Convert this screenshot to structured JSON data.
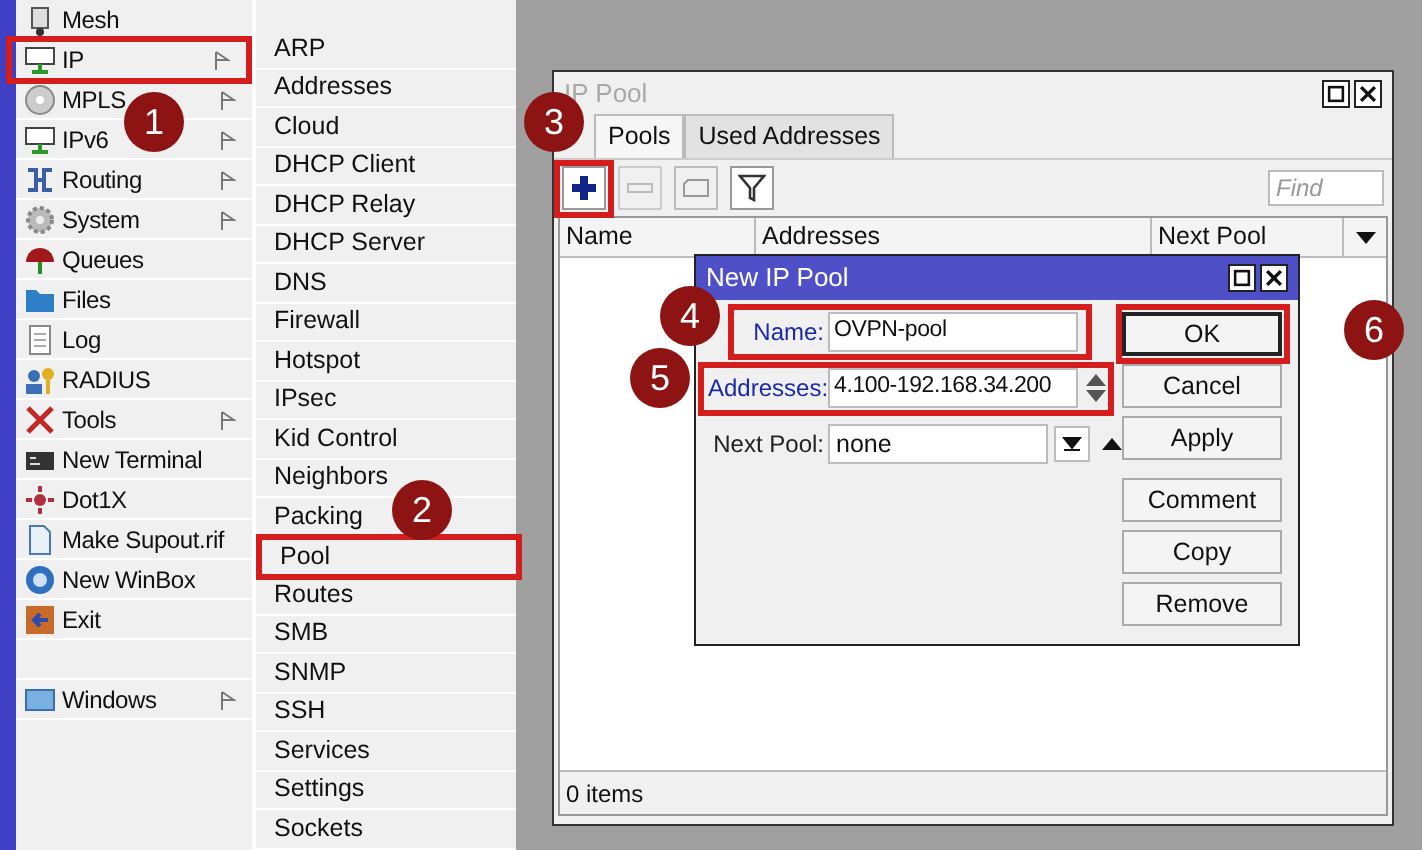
{
  "menu": {
    "items": [
      {
        "kind": "item",
        "label": "Mesh",
        "arrow": false,
        "highlighted": false
      },
      {
        "kind": "item",
        "label": "IP",
        "arrow": true,
        "highlighted": true
      },
      {
        "kind": "item",
        "label": "MPLS",
        "arrow": true
      },
      {
        "kind": "item",
        "label": "IPv6",
        "arrow": true
      },
      {
        "kind": "item",
        "label": "Routing",
        "arrow": true
      },
      {
        "kind": "item",
        "label": "System",
        "arrow": true
      },
      {
        "kind": "item",
        "label": "Queues",
        "arrow": false
      },
      {
        "kind": "item",
        "label": "Files",
        "arrow": false
      },
      {
        "kind": "item",
        "label": "Log",
        "arrow": false
      },
      {
        "kind": "item",
        "label": "RADIUS",
        "arrow": false
      },
      {
        "kind": "item",
        "label": "Tools",
        "arrow": true
      },
      {
        "kind": "item",
        "label": "New Terminal",
        "arrow": false
      },
      {
        "kind": "item",
        "label": "Dot1X",
        "arrow": false
      },
      {
        "kind": "item",
        "label": "Make Supout.rif",
        "arrow": false
      },
      {
        "kind": "item",
        "label": "New WinBox",
        "arrow": false
      },
      {
        "kind": "item",
        "label": "Exit",
        "arrow": false
      },
      {
        "kind": "spacer"
      },
      {
        "kind": "item",
        "label": "Windows",
        "arrow": true
      }
    ]
  },
  "submenu": {
    "items": [
      {
        "label": "ARP"
      },
      {
        "label": "Addresses"
      },
      {
        "label": "Cloud"
      },
      {
        "label": "DHCP Client"
      },
      {
        "label": "DHCP Relay"
      },
      {
        "label": "DHCP Server"
      },
      {
        "label": "DNS"
      },
      {
        "label": "Firewall"
      },
      {
        "label": "Hotspot"
      },
      {
        "label": "IPsec"
      },
      {
        "label": "Kid Control"
      },
      {
        "label": "Neighbors"
      },
      {
        "label": "Packing"
      },
      {
        "label": "Pool",
        "highlighted": true
      },
      {
        "label": "Routes"
      },
      {
        "label": "SMB"
      },
      {
        "label": "SNMP"
      },
      {
        "label": "SSH"
      },
      {
        "label": "Services"
      },
      {
        "label": "Settings"
      },
      {
        "label": "Sockets"
      }
    ]
  },
  "window": {
    "title": "IP Pool",
    "tabs": [
      {
        "label": "Pools",
        "selected": true
      },
      {
        "label": "Used Addresses",
        "selected": false
      }
    ],
    "find_placeholder": "Find",
    "columns": [
      "Name",
      "Addresses",
      "Next Pool"
    ],
    "status": "0 items"
  },
  "dialog": {
    "title": "New IP Pool",
    "fields": [
      {
        "kind": "text",
        "label": "Name:",
        "value": "OVPN-pool",
        "required": true
      },
      {
        "kind": "spinner",
        "label": "Addresses:",
        "value": "4.100-192.168.34.200",
        "required": true
      },
      {
        "kind": "select",
        "label": "Next Pool:",
        "value": "none",
        "required": false
      }
    ],
    "buttons": [
      {
        "label": "OK",
        "default": true
      },
      {
        "label": "Cancel",
        "default": false
      },
      {
        "label": "Apply",
        "default": false
      },
      {
        "label": "Comment",
        "default": false
      },
      {
        "label": "Copy",
        "default": false
      },
      {
        "label": "Remove",
        "default": false
      }
    ]
  },
  "annotations": [
    {
      "number": "1"
    },
    {
      "number": "2"
    },
    {
      "number": "3"
    },
    {
      "number": "4"
    },
    {
      "number": "5"
    },
    {
      "number": "6"
    }
  ]
}
